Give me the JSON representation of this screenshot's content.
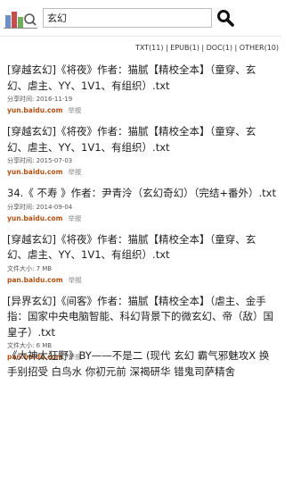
{
  "search": {
    "value": "玄幻"
  },
  "filters": {
    "txt": "TXT(11)",
    "epub": "EPUB(1)",
    "doc": "DOC(1)",
    "other": "OTHER(10)",
    "sep": " | "
  },
  "results": [
    {
      "title": "[穿越玄幻]《将夜》作者：猫腻【精校全本】（童穿、玄幻、虐主、YY、1V1、有组织）.txt",
      "meta": "分享时间: 2016-11-19",
      "domain": "yun.baidu.com",
      "report": "举报"
    },
    {
      "title": "[穿越玄幻]《将夜》作者：猫腻【精校全本】（童穿、玄幻、虐主、YY、1V1、有组织）.txt",
      "meta": "分享时间: 2015-07-03",
      "domain": "yun.baidu.com",
      "report": "举报"
    },
    {
      "title": "34.《 不寿 》作者：尹青泠（玄幻奇幻）（完结+番外）.txt",
      "meta": "分享时间: 2014-09-04",
      "domain": "yun.baidu.com",
      "report": "举报"
    },
    {
      "title": "[穿越玄幻]《将夜》作者：猫腻【精校全本】（童穿、玄幻、虐主、YY、1V1、有组织）.txt",
      "meta": "文件大小: 7 MB",
      "domain": "pan.baidu.com",
      "report": "举报"
    },
    {
      "title": "[异界玄幻]《间客》作者：猫腻【精校全本】（虐主、金手指：国家中央电脑智能、科幻背景下的微玄幻、帝（敌）国皇子）.txt",
      "meta": "文件大小: 6 MB",
      "domain": "pan.baidu.com",
      "report": "举报"
    }
  ],
  "partial_result": {
    "title": "《大神太狂野》BY——不是二 (现代 玄幻 霸气邪魅攻X 换手别招受 白鸟水 你初元前 深褐研华 错鬼司萨精舍"
  },
  "colors": {
    "domain": "#b34f12",
    "search_icon": "#111111"
  },
  "icons": {
    "logo": "reader-logo-icon",
    "search": "search-icon"
  }
}
